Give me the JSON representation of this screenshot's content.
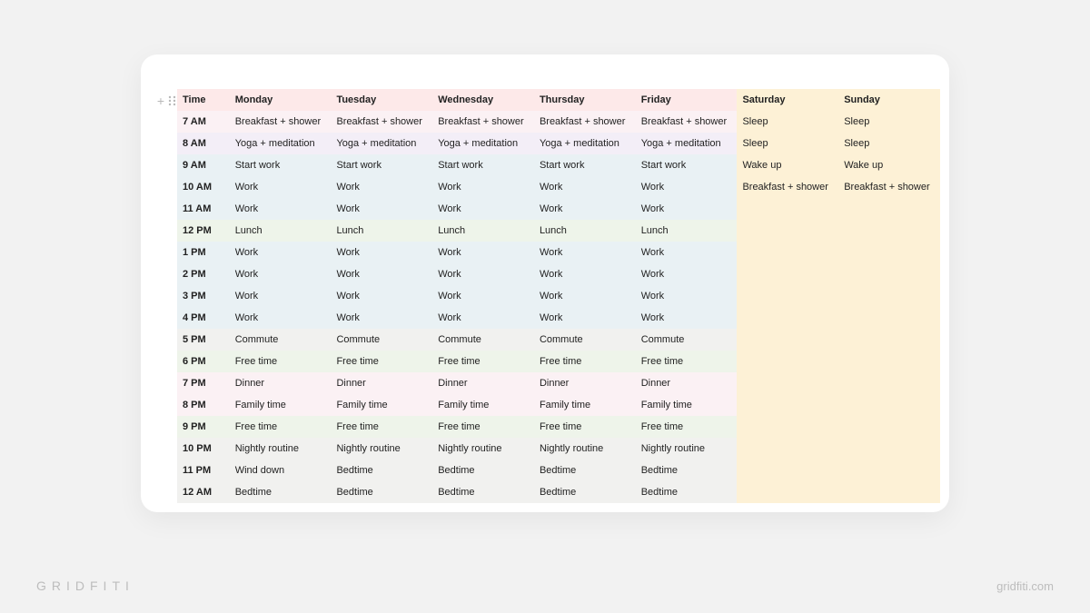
{
  "brand": {
    "left": "GRIDFITI",
    "right": "gridfiti.com"
  },
  "schedule": {
    "headers": [
      "Time",
      "Monday",
      "Tuesday",
      "Wednesday",
      "Thursday",
      "Friday",
      "Saturday",
      "Sunday"
    ],
    "rows": [
      {
        "time": "7 AM",
        "bg": "pink",
        "cells": [
          "Breakfast + shower",
          "Breakfast + shower",
          "Breakfast + shower",
          "Breakfast + shower",
          "Breakfast + shower",
          "Sleep",
          "Sleep"
        ]
      },
      {
        "time": "8 AM",
        "bg": "lav",
        "cells": [
          "Yoga + meditation",
          "Yoga + meditation",
          "Yoga + meditation",
          "Yoga + meditation",
          "Yoga + meditation",
          "Sleep",
          "Sleep"
        ]
      },
      {
        "time": "9 AM",
        "bg": "blue",
        "cells": [
          "Start work",
          "Start work",
          "Start work",
          "Start work",
          "Start work",
          "Wake up",
          "Wake up"
        ]
      },
      {
        "time": "10 AM",
        "bg": "blue",
        "cells": [
          "Work",
          "Work",
          "Work",
          "Work",
          "Work",
          "Breakfast + shower",
          "Breakfast + shower"
        ]
      },
      {
        "time": "11 AM",
        "bg": "blue",
        "cells": [
          "Work",
          "Work",
          "Work",
          "Work",
          "Work",
          "",
          ""
        ]
      },
      {
        "time": "12 PM",
        "bg": "green",
        "cells": [
          "Lunch",
          "Lunch",
          "Lunch",
          "Lunch",
          "Lunch",
          "",
          ""
        ]
      },
      {
        "time": "1 PM",
        "bg": "blue",
        "cells": [
          "Work",
          "Work",
          "Work",
          "Work",
          "Work",
          "",
          ""
        ]
      },
      {
        "time": "2 PM",
        "bg": "blue",
        "cells": [
          "Work",
          "Work",
          "Work",
          "Work",
          "Work",
          "",
          ""
        ]
      },
      {
        "time": "3 PM",
        "bg": "blue",
        "cells": [
          "Work",
          "Work",
          "Work",
          "Work",
          "Work",
          "",
          ""
        ]
      },
      {
        "time": "4 PM",
        "bg": "blue",
        "cells": [
          "Work",
          "Work",
          "Work",
          "Work",
          "Work",
          "",
          ""
        ]
      },
      {
        "time": "5 PM",
        "bg": "grey",
        "cells": [
          "Commute",
          "Commute",
          "Commute",
          "Commute",
          "Commute",
          "",
          ""
        ]
      },
      {
        "time": "6 PM",
        "bg": "green",
        "cells": [
          "Free time",
          "Free time",
          "Free time",
          "Free time",
          "Free time",
          "",
          ""
        ]
      },
      {
        "time": "7 PM",
        "bg": "pink",
        "cells": [
          "Dinner",
          "Dinner",
          "Dinner",
          "Dinner",
          "Dinner",
          "",
          ""
        ]
      },
      {
        "time": "8 PM",
        "bg": "pink",
        "cells": [
          "Family time",
          "Family time",
          "Family time",
          "Family time",
          "Family time",
          "",
          ""
        ]
      },
      {
        "time": "9 PM",
        "bg": "green",
        "cells": [
          "Free time",
          "Free time",
          "Free time",
          "Free time",
          "Free time",
          "",
          ""
        ]
      },
      {
        "time": "10 PM",
        "bg": "grey",
        "cells": [
          "Nightly routine",
          "Nightly routine",
          "Nightly routine",
          "Nightly routine",
          "Nightly routine",
          "",
          ""
        ]
      },
      {
        "time": "11 PM",
        "bg": "grey",
        "cells": [
          "Wind down",
          "Bedtime",
          "Bedtime",
          "Bedtime",
          "Bedtime",
          "",
          ""
        ]
      },
      {
        "time": "12 AM",
        "bg": "grey",
        "cells": [
          "Bedtime",
          "Bedtime",
          "Bedtime",
          "Bedtime",
          "Bedtime",
          "",
          ""
        ]
      }
    ]
  }
}
